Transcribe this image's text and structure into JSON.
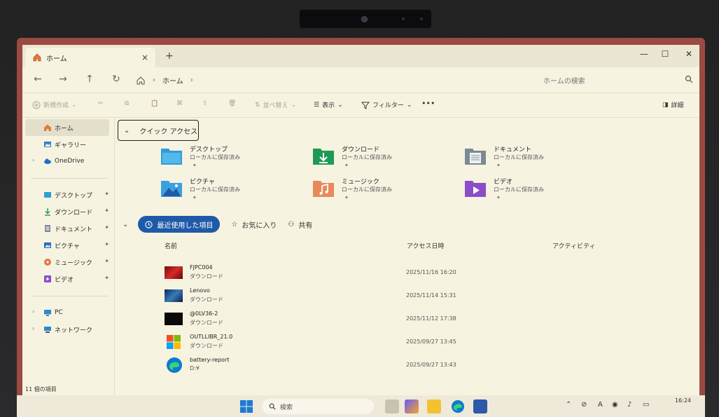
{
  "window": {
    "tab_title": "ホーム",
    "new_tab": "+",
    "close_tab": "×",
    "minimize": "—",
    "maximize": "☐",
    "close": "✕"
  },
  "nav": {
    "back": "←",
    "forward": "→",
    "up": "↑",
    "refresh": "↻",
    "breadcrumb": [
      "ホーム"
    ],
    "search_placeholder": "ホームの検索"
  },
  "toolbar": {
    "new_label": "新規作成",
    "sort_label": "並べ替え",
    "view_label": "表示",
    "filter_label": "フィルター",
    "more_label": "•••",
    "details_label": "詳細"
  },
  "sidebar": {
    "items": [
      {
        "label": "ホーム",
        "icon": "home-icon",
        "selected": true
      },
      {
        "label": "ギャラリー",
        "icon": "gallery-icon"
      },
      {
        "label": "OneDrive",
        "icon": "cloud-icon",
        "chevron": "›"
      }
    ],
    "pinned": [
      {
        "label": "デスクトップ",
        "icon": "desktop-icon",
        "pin": "📌"
      },
      {
        "label": "ダウンロード",
        "icon": "download-icon",
        "pin": "📌"
      },
      {
        "label": "ドキュメント",
        "icon": "document-icon",
        "pin": "📌"
      },
      {
        "label": "ピクチャ",
        "icon": "pictures-icon",
        "pin": "📌"
      },
      {
        "label": "ミュージック",
        "icon": "music-icon",
        "pin": "📌"
      },
      {
        "label": "ビデオ",
        "icon": "video-icon",
        "pin": "📌"
      }
    ],
    "tree": [
      {
        "label": "PC",
        "icon": "pc-icon",
        "chevron": "›"
      },
      {
        "label": "ネットワーク",
        "icon": "network-icon",
        "chevron": "›"
      }
    ]
  },
  "quick_access": {
    "header": "クイック アクセス",
    "items": [
      {
        "name": "デスクトップ",
        "sub": "ローカルに保存済み",
        "icon": "desktop-folder-icon",
        "color": "#2f9ed8"
      },
      {
        "name": "ダウンロード",
        "sub": "ローカルに保存済み",
        "icon": "download-folder-icon",
        "color": "#1f9a55"
      },
      {
        "name": "ドキュメント",
        "sub": "ローカルに保存済み",
        "icon": "documents-folder-icon",
        "color": "#7d8a94"
      },
      {
        "name": "ピクチャ",
        "sub": "ローカルに保存済み",
        "icon": "pictures-folder-icon",
        "color": "#3aa0e0"
      },
      {
        "name": "ミュージック",
        "sub": "ローカルに保存済み",
        "icon": "music-folder-icon",
        "color": "#e07c4a"
      },
      {
        "name": "ビデオ",
        "sub": "ローカルに保存済み",
        "icon": "videos-folder-icon",
        "color": "#8a4ec8"
      }
    ]
  },
  "recent": {
    "tabs": [
      "最近使用した項目",
      "お気に入り",
      "共有"
    ],
    "columns": [
      "名前",
      "アクセス日時",
      "アクティビティ"
    ],
    "rows": [
      {
        "name": "FJPC004",
        "location": "ダウンロード",
        "date": "2025/11/16 16:20",
        "thumb": "red-image-thumb"
      },
      {
        "name": "Lenovo",
        "location": "ダウンロード",
        "date": "2025/11/14 15:31",
        "thumb": "blue-image-thumb"
      },
      {
        "name": "@0LV36-2",
        "location": "ダウンロード",
        "date": "2025/11/12 17:38",
        "thumb": "dark-image-thumb"
      },
      {
        "name": "OUTLLIBR_21.0",
        "location": "ダウンロード",
        "date": "2025/09/27 13:45",
        "thumb": "installer-icon"
      },
      {
        "name": "battery-report",
        "location": "D:¥",
        "date": "2025/09/27 13:43",
        "thumb": "edge-icon"
      }
    ]
  },
  "status": {
    "count": "11 個の項目"
  },
  "taskbar": {
    "search_label": "検索",
    "time": "16:24"
  }
}
